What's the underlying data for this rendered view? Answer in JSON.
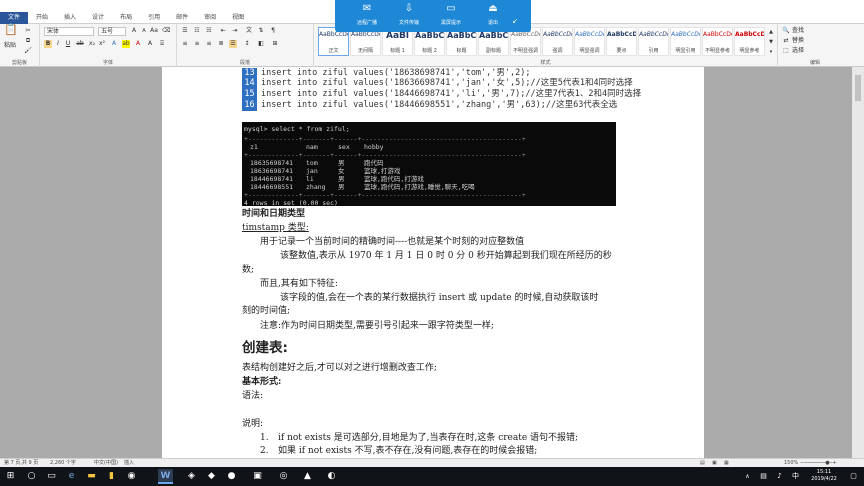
{
  "tabs": [
    "文件",
    "开始",
    "插入",
    "设计",
    "布局",
    "引用",
    "邮件",
    "审阅",
    "视图"
  ],
  "clipboard": {
    "paste": "粘贴",
    "label": "剪贴板"
  },
  "font": {
    "name": "宋体",
    "size": "五号",
    "label": "字体"
  },
  "paragraph": {
    "label": "段落"
  },
  "styles": {
    "label": "样式",
    "items": [
      {
        "sample": "AaBbCcDd",
        "name": "正文"
      },
      {
        "sample": "AaBbCcDd",
        "name": "无间隔"
      },
      {
        "sample": "AaBl",
        "name": "标题 1"
      },
      {
        "sample": "AaBbC",
        "name": "标题 2"
      },
      {
        "sample": "AaBbC",
        "name": "标题"
      },
      {
        "sample": "AaBbC",
        "name": "副标题"
      },
      {
        "sample": "AaBbCcDd",
        "name": "不明显强调"
      },
      {
        "sample": "AaBbCcDd",
        "name": "强调"
      },
      {
        "sample": "AaBbCcDd",
        "name": "明显强调"
      },
      {
        "sample": "AaBbCcDd",
        "name": "要点"
      },
      {
        "sample": "AaBbCcDd",
        "name": "引用"
      },
      {
        "sample": "AaBbCcDd",
        "name": "明显引用"
      },
      {
        "sample": "AaBbCcDd",
        "name": "不明显参考"
      },
      {
        "sample": "AaBbCcDd",
        "name": "明显参考"
      }
    ]
  },
  "editing": {
    "find": "查找",
    "replace": "替换",
    "select": "选择",
    "label": "编辑"
  },
  "remote_bar": {
    "items": [
      "远程广播",
      "文件传输",
      "黑屏提示",
      "退出"
    ]
  },
  "code_lines": [
    {
      "num": "13",
      "text": "insert into ziful values('18638698741','tom','男',2);"
    },
    {
      "num": "14",
      "text": "insert into ziful values('18636698741','jan','女',5);//这里5代表1和4同时选择"
    },
    {
      "num": "15",
      "text": "insert into ziful values('18446698741','li','男',7);//这里7代表1、2和4同时选择"
    },
    {
      "num": "16",
      "text": "insert into ziful values('18446698551','zhang','男',63);//这里63代表全选"
    }
  ],
  "terminal": {
    "prompt": "mysql> select * from ziful;",
    "separator": "+-------------+-------+------+-----------------------------------------+",
    "headers": [
      "z1",
      "nam",
      "sex",
      "hobby"
    ],
    "rows": [
      [
        "18635698741",
        "tom",
        "男",
        "跑代码"
      ],
      [
        "18636698741",
        "jan",
        "女",
        "篮球,打游戏"
      ],
      [
        "18446698741",
        "li",
        "男",
        "篮球,跑代码,打游戏"
      ],
      [
        "18446698551",
        "zhang",
        "男",
        "篮球,跑代码,打游戏,睡觉,聊天,吃喝"
      ]
    ],
    "footer": "4 rows in set (0.00 sec)"
  },
  "body": {
    "heading_time": "时间和日期类型",
    "timestamp_label": "timstamp 类型:",
    "p1": "用于记录一个当前时间的精确时间----也就是某个时刻的对应整数值",
    "p2a": "该整数值,表示从 1970 年 1 月 1 日 0 时 0 分 0 秒开始算起到我们现在所经历的秒",
    "p2b": "数;",
    "p3": "而且,其有如下特征:",
    "p4a": "该字段的值,会在一个表的某行数据执行 insert 或 update 的时候,自动获取该时",
    "p4b": "刻的时间值;",
    "p5": "注意:作为时间日期类型,需要引号引起来一跟字符类型一样;",
    "heading_create": "创建表:",
    "p6": "表结构创建好之后,才可以对之进行增删改查工作;",
    "basic_form": "基本形式:",
    "syntax": "语法:",
    "note": "说明:",
    "li1": "if not exists 是可选部分,目地是为了,当表存在时,这条 create 语句不报错;",
    "li2": "如果 if not exists 不写,表不存在,没有问题,表存在的时候会报错;"
  },
  "statusbar": {
    "page": "第 7 页,共 9 页",
    "words": "2,260 个字",
    "lang": "中文(中国)",
    "mode": "插入",
    "zoom": "150%"
  },
  "taskbar": {
    "time": "15:11",
    "date": "2019/4/22"
  }
}
